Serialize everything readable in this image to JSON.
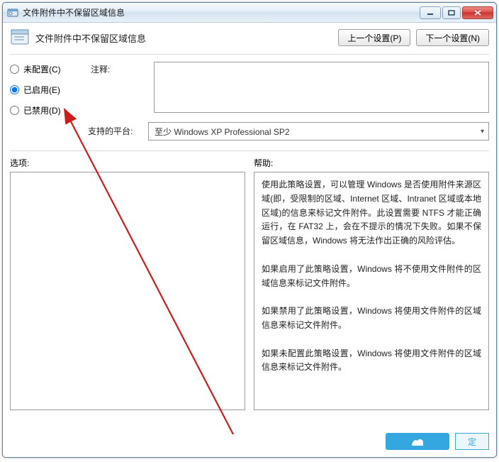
{
  "window": {
    "title": "文件附件中不保留区域信息"
  },
  "header": {
    "title": "文件附件中不保留区域信息",
    "prev_btn": "上一个设置(P)",
    "next_btn": "下一个设置(N)"
  },
  "radios": {
    "not_configured": "未配置(C)",
    "enabled": "已启用(E)",
    "disabled": "已禁用(D)"
  },
  "labels": {
    "comment": "注释:",
    "platform": "支持的平台:",
    "options": "选项:",
    "help": "帮助:"
  },
  "platform_value": "至少 Windows XP Professional SP2",
  "help_paragraphs": [
    "使用此策略设置，可以管理 Windows 是否使用附件来源区域(即，受限制的区域、Internet 区域、Intranet 区域或本地区域)的信息来标记文件附件。此设置需要 NTFS 才能正确运行，在 FAT32 上，会在不提示的情况下失败。如果不保留区域信息，Windows 将无法作出正确的风险评估。",
    "如果启用了此策略设置，Windows 将不使用文件附件的区域信息来标记文件附件。",
    "如果禁用了此策略设置，Windows 将使用文件附件的区域信息来标记文件附件。",
    "如果未配置此策略设置，Windows 将使用文件附件的区域信息来标记文件附件。"
  ],
  "footer": {
    "ok": "定"
  }
}
